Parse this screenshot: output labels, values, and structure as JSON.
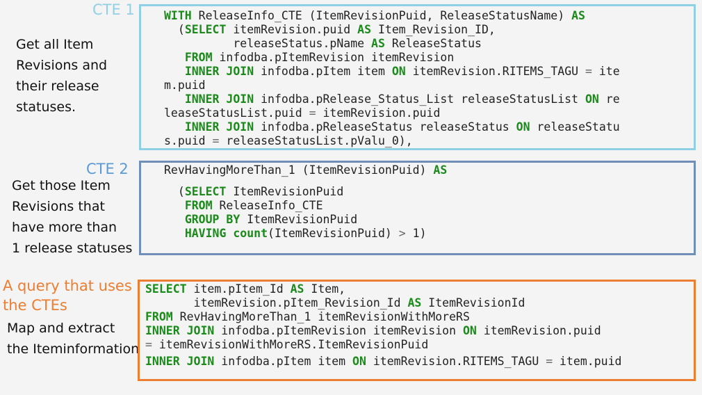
{
  "cte1": {
    "title": "CTE 1",
    "title_color": "#8fd0e6",
    "border_color": "#8fd0e6",
    "description": [
      "Get all Item",
      "Revisions and",
      "their release",
      "statuses."
    ],
    "code": [
      [
        {
          "t": "WITH",
          "k": 1
        },
        {
          "t": " ReleaseInfo_CTE (ItemRevisionPuid, ReleaseStatusName) "
        },
        {
          "t": "AS",
          "k": 1
        }
      ],
      [
        {
          "t": "  ("
        },
        {
          "t": "SELECT",
          "k": 1
        },
        {
          "t": " itemRevision.puid "
        },
        {
          "t": "AS",
          "k": 1
        },
        {
          "t": " Item_Revision_ID,"
        }
      ],
      [
        {
          "t": "          releaseStatus.pName "
        },
        {
          "t": "AS",
          "k": 1
        },
        {
          "t": " ReleaseStatus"
        }
      ],
      [
        {
          "t": "   "
        },
        {
          "t": "FROM",
          "k": 1
        },
        {
          "t": " infodba.pItemRevision itemRevision"
        }
      ],
      [
        {
          "t": "   "
        },
        {
          "t": "INNER JOIN",
          "k": 1
        },
        {
          "t": " infodba.pItem item "
        },
        {
          "t": "ON",
          "k": 1
        },
        {
          "t": " itemRevision.RITEMS_TAGU "
        },
        {
          "t": "=",
          "o": 1
        },
        {
          "t": " ite"
        }
      ],
      [
        {
          "t": "m.puid"
        }
      ],
      [
        {
          "t": "   "
        },
        {
          "t": "INNER JOIN",
          "k": 1
        },
        {
          "t": " infodba.pRelease_Status_List releaseStatusList "
        },
        {
          "t": "ON",
          "k": 1
        },
        {
          "t": " re"
        }
      ],
      [
        {
          "t": "leaseStatusList.puid "
        },
        {
          "t": "=",
          "o": 1
        },
        {
          "t": " itemRevision.puid"
        }
      ],
      [
        {
          "t": "   "
        },
        {
          "t": "INNER JOIN",
          "k": 1
        },
        {
          "t": " infodba.pReleaseStatus releaseStatus "
        },
        {
          "t": "ON",
          "k": 1
        },
        {
          "t": " releaseStatu"
        }
      ],
      [
        {
          "t": "s.puid "
        },
        {
          "t": "=",
          "o": 1
        },
        {
          "t": " releaseStatusList.pValu_0),"
        }
      ]
    ]
  },
  "cte2": {
    "title": "CTE 2",
    "title_color": "#5b9bd5",
    "border_color": "#6f8fb8",
    "description": [
      "Get those Item",
      "Revisions that",
      "have more than",
      "1 release statuses"
    ],
    "code_head": [
      [
        {
          "t": "RevHavingMoreThan_1 (ItemRevisionPuid) "
        },
        {
          "t": "AS",
          "k": 1
        }
      ]
    ],
    "code": [
      [
        {
          "t": "  ("
        },
        {
          "t": "SELECT",
          "k": 1
        },
        {
          "t": " ItemRevisionPuid"
        }
      ],
      [
        {
          "t": "   "
        },
        {
          "t": "FROM",
          "k": 1
        },
        {
          "t": " ReleaseInfo_CTE"
        }
      ],
      [
        {
          "t": "   "
        },
        {
          "t": "GROUP BY",
          "k": 1
        },
        {
          "t": " ItemRevisionPuid"
        }
      ],
      [
        {
          "t": "   "
        },
        {
          "t": "HAVING",
          "k": 1
        },
        {
          "t": " "
        },
        {
          "t": "count",
          "k": 1
        },
        {
          "t": "(ItemRevisionPuid) "
        },
        {
          "t": ">",
          "o": 1
        },
        {
          "t": " 1)"
        }
      ]
    ]
  },
  "query": {
    "title_lines": [
      "A query that uses",
      "the CTEs"
    ],
    "title_color": "#ed7d31",
    "border_color": "#ed7d31",
    "description": [
      "Map and extract",
      "the Iteminformation"
    ],
    "code": [
      [
        {
          "t": "SELECT",
          "k": 1
        },
        {
          "t": " item.pItem_Id "
        },
        {
          "t": "AS",
          "k": 1
        },
        {
          "t": " Item,"
        }
      ],
      [
        {
          "t": "       itemRevision.pItem_Revision_Id "
        },
        {
          "t": "AS",
          "k": 1
        },
        {
          "t": " ItemRevisionId"
        }
      ],
      [
        {
          "t": "FROM",
          "k": 1
        },
        {
          "t": " RevHavingMoreThan_1 itemRevisionWithMoreRS"
        }
      ],
      [
        {
          "t": "INNER JOIN",
          "k": 1
        },
        {
          "t": " infodba.pItemRevision itemRevision "
        },
        {
          "t": "ON",
          "k": 1
        },
        {
          "t": " itemRevision.puid"
        }
      ],
      [
        {
          "t": "=",
          "o": 1
        },
        {
          "t": " itemRevisionWithMoreRS.ItemRevisionPuid"
        }
      ]
    ],
    "code_tail": [
      [
        {
          "t": "INNER JOIN",
          "k": 1
        },
        {
          "t": " infodba.pItem item "
        },
        {
          "t": "ON",
          "k": 1
        },
        {
          "t": " itemRevision.RITEMS_TAGU "
        },
        {
          "t": "=",
          "o": 1
        },
        {
          "t": " item.puid"
        }
      ]
    ]
  }
}
